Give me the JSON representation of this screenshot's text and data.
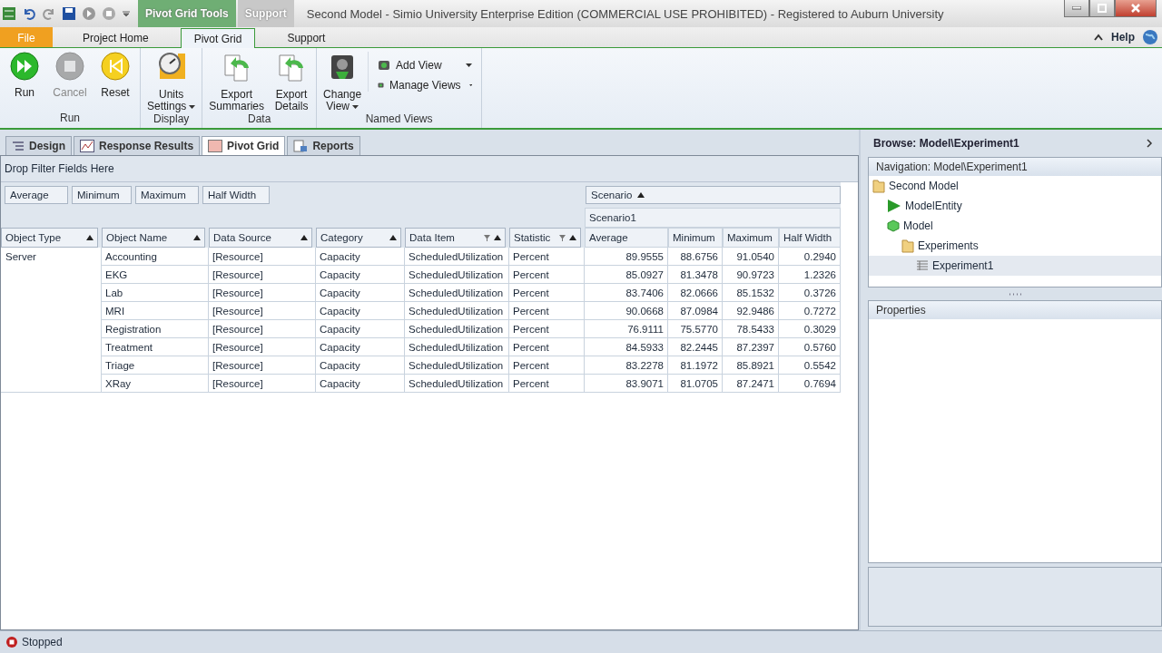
{
  "window": {
    "title": "Second Model - Simio University Enterprise Edition (COMMERCIAL USE PROHIBITED) - Registered to Auburn University",
    "contextual_tabs": [
      "Pivot Grid Tools",
      "Support"
    ]
  },
  "ribbon_tabs": [
    {
      "label": "File",
      "kind": "file",
      "selected": false
    },
    {
      "label": "Project Home",
      "kind": "tab",
      "selected": false
    },
    {
      "label": "Pivot Grid",
      "kind": "tab",
      "selected": true
    },
    {
      "label": "Support",
      "kind": "tab",
      "selected": false
    }
  ],
  "help": "Help",
  "ribbon_groups": [
    {
      "label": "Run",
      "buttons": [
        {
          "label": "Run",
          "kind": "large",
          "disabled": false,
          "dropdown": false
        },
        {
          "label": "Cancel",
          "kind": "large",
          "disabled": true,
          "dropdown": false
        },
        {
          "label": "Reset",
          "kind": "large",
          "disabled": false,
          "dropdown": false
        }
      ]
    },
    {
      "label": "Display",
      "buttons": [
        {
          "label": "Units Settings",
          "kind": "large",
          "disabled": false,
          "dropdown": true
        }
      ]
    },
    {
      "label": "Data",
      "buttons": [
        {
          "label": "Export Summaries",
          "kind": "large",
          "disabled": false,
          "dropdown": false
        },
        {
          "label": "Export Details",
          "kind": "large",
          "disabled": false,
          "dropdown": false
        }
      ]
    },
    {
      "label": "Named Views",
      "buttons": [
        {
          "label": "Change View",
          "kind": "large",
          "disabled": false,
          "dropdown": true
        },
        {
          "label": "Add View",
          "kind": "small",
          "disabled": false,
          "dropdown": true
        },
        {
          "label": "Manage Views",
          "kind": "small",
          "disabled": false,
          "dropdown": true
        }
      ]
    }
  ],
  "doc_tabs": [
    {
      "label": "Design",
      "selected": false
    },
    {
      "label": "Response Results",
      "selected": false
    },
    {
      "label": "Pivot Grid",
      "selected": true
    },
    {
      "label": "Reports",
      "selected": false
    }
  ],
  "pivot": {
    "filter_area": "Drop Filter Fields Here",
    "data_fields": [
      "Average",
      "Minimum",
      "Maximum",
      "Half Width"
    ],
    "column_field": "Scenario",
    "row_fields": [
      {
        "label": "Object Type",
        "filter": false
      },
      {
        "label": "Object Name",
        "filter": false
      },
      {
        "label": "Data Source",
        "filter": false
      },
      {
        "label": "Category",
        "filter": false
      },
      {
        "label": "Data Item",
        "filter": true
      },
      {
        "label": "Statistic",
        "filter": true
      }
    ],
    "scenario": "Scenario1",
    "value_columns": [
      "Average",
      "Minimum",
      "Maximum",
      "Half Width"
    ],
    "row_group": "Server",
    "rows": [
      {
        "name": "Accounting",
        "source": "[Resource]",
        "category": "Capacity",
        "item": "ScheduledUtilization",
        "statistic": "Percent",
        "values": [
          "89.9555",
          "88.6756",
          "91.0540",
          "0.2940"
        ]
      },
      {
        "name": "EKG",
        "source": "[Resource]",
        "category": "Capacity",
        "item": "ScheduledUtilization",
        "statistic": "Percent",
        "values": [
          "85.0927",
          "81.3478",
          "90.9723",
          "1.2326"
        ]
      },
      {
        "name": "Lab",
        "source": "[Resource]",
        "category": "Capacity",
        "item": "ScheduledUtilization",
        "statistic": "Percent",
        "values": [
          "83.7406",
          "82.0666",
          "85.1532",
          "0.3726"
        ]
      },
      {
        "name": "MRI",
        "source": "[Resource]",
        "category": "Capacity",
        "item": "ScheduledUtilization",
        "statistic": "Percent",
        "values": [
          "90.0668",
          "87.0984",
          "92.9486",
          "0.7272"
        ]
      },
      {
        "name": "Registration",
        "source": "[Resource]",
        "category": "Capacity",
        "item": "ScheduledUtilization",
        "statistic": "Percent",
        "values": [
          "76.9111",
          "75.5770",
          "78.5433",
          "0.3029"
        ]
      },
      {
        "name": "Treatment",
        "source": "[Resource]",
        "category": "Capacity",
        "item": "ScheduledUtilization",
        "statistic": "Percent",
        "values": [
          "84.5933",
          "82.2445",
          "87.2397",
          "0.5760"
        ]
      },
      {
        "name": "Triage",
        "source": "[Resource]",
        "category": "Capacity",
        "item": "ScheduledUtilization",
        "statistic": "Percent",
        "values": [
          "83.2278",
          "81.1972",
          "85.8921",
          "0.5542"
        ]
      },
      {
        "name": "XRay",
        "source": "[Resource]",
        "category": "Capacity",
        "item": "ScheduledUtilization",
        "statistic": "Percent",
        "values": [
          "83.9071",
          "81.0705",
          "87.2471",
          "0.7694"
        ]
      }
    ]
  },
  "browse": {
    "title": "Browse: Model\\Experiment1",
    "navigation_title": "Navigation: Model\\Experiment1",
    "tree": [
      {
        "label": "Second Model",
        "kind": "folder",
        "selected": false,
        "children": [
          {
            "label": "ModelEntity",
            "kind": "entity",
            "selected": false
          },
          {
            "label": "Model",
            "kind": "model",
            "selected": false,
            "children": [
              {
                "label": "Experiments",
                "kind": "folder",
                "selected": false,
                "children": [
                  {
                    "label": "Experiment1",
                    "kind": "experiment",
                    "selected": true
                  }
                ]
              }
            ]
          }
        ]
      }
    ],
    "properties_title": "Properties"
  },
  "status_bar": {
    "status": "Stopped"
  }
}
